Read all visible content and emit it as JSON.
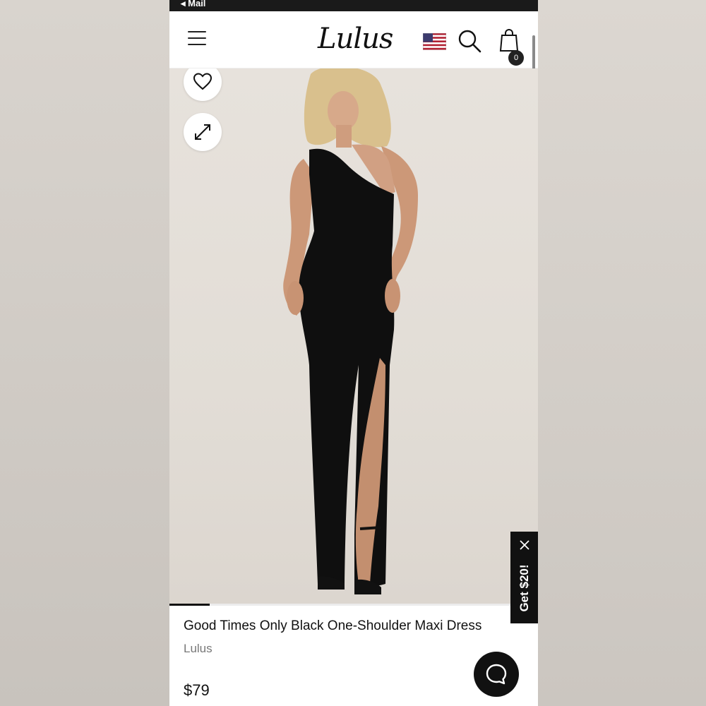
{
  "status_bar": {
    "back_label": "◂ Mail"
  },
  "header": {
    "logo": "Lulus",
    "cart_count": "0",
    "icons": {
      "menu": "hamburger-menu-icon",
      "flag": "us-flag-icon",
      "search": "search-icon",
      "cart": "shopping-bag-icon"
    }
  },
  "hero": {
    "icons": {
      "wishlist": "heart-icon",
      "expand": "expand-arrows-icon"
    },
    "image_progress": 0.11
  },
  "promo": {
    "label": "Get $20!",
    "close_icon": "close-icon"
  },
  "product": {
    "title": "Good Times Only Black One-Shoulder Maxi Dress",
    "brand": "Lulus",
    "price": "$79"
  },
  "chat": {
    "icon": "chat-bubble-icon"
  },
  "colors": {
    "accent": "#111111",
    "flag_red": "#b22234",
    "flag_blue": "#3c3b6e"
  }
}
